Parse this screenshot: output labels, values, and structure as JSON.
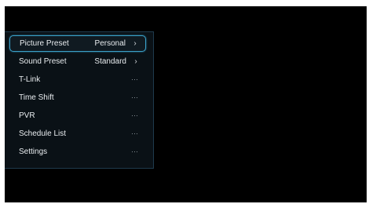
{
  "menu": {
    "items": [
      {
        "label": "Picture Preset",
        "value": "Personal",
        "indicator": "chevron-right-icon",
        "selected": true
      },
      {
        "label": "Sound Preset",
        "value": "Standard",
        "indicator": "chevron-right-icon",
        "selected": false
      },
      {
        "label": "T-Link",
        "value": "",
        "indicator": "more-dots-icon",
        "selected": false
      },
      {
        "label": "Time Shift",
        "value": "",
        "indicator": "more-dots-icon",
        "selected": false
      },
      {
        "label": "PVR",
        "value": "",
        "indicator": "more-dots-icon",
        "selected": false
      },
      {
        "label": "Schedule List",
        "value": "",
        "indicator": "more-dots-icon",
        "selected": false
      },
      {
        "label": "Settings",
        "value": "",
        "indicator": "more-dots-icon",
        "selected": false
      }
    ]
  },
  "colors": {
    "background": "#000000",
    "panel": "#0a1116",
    "selection_border": "#3aa0c8",
    "text": "#e8ecef"
  }
}
